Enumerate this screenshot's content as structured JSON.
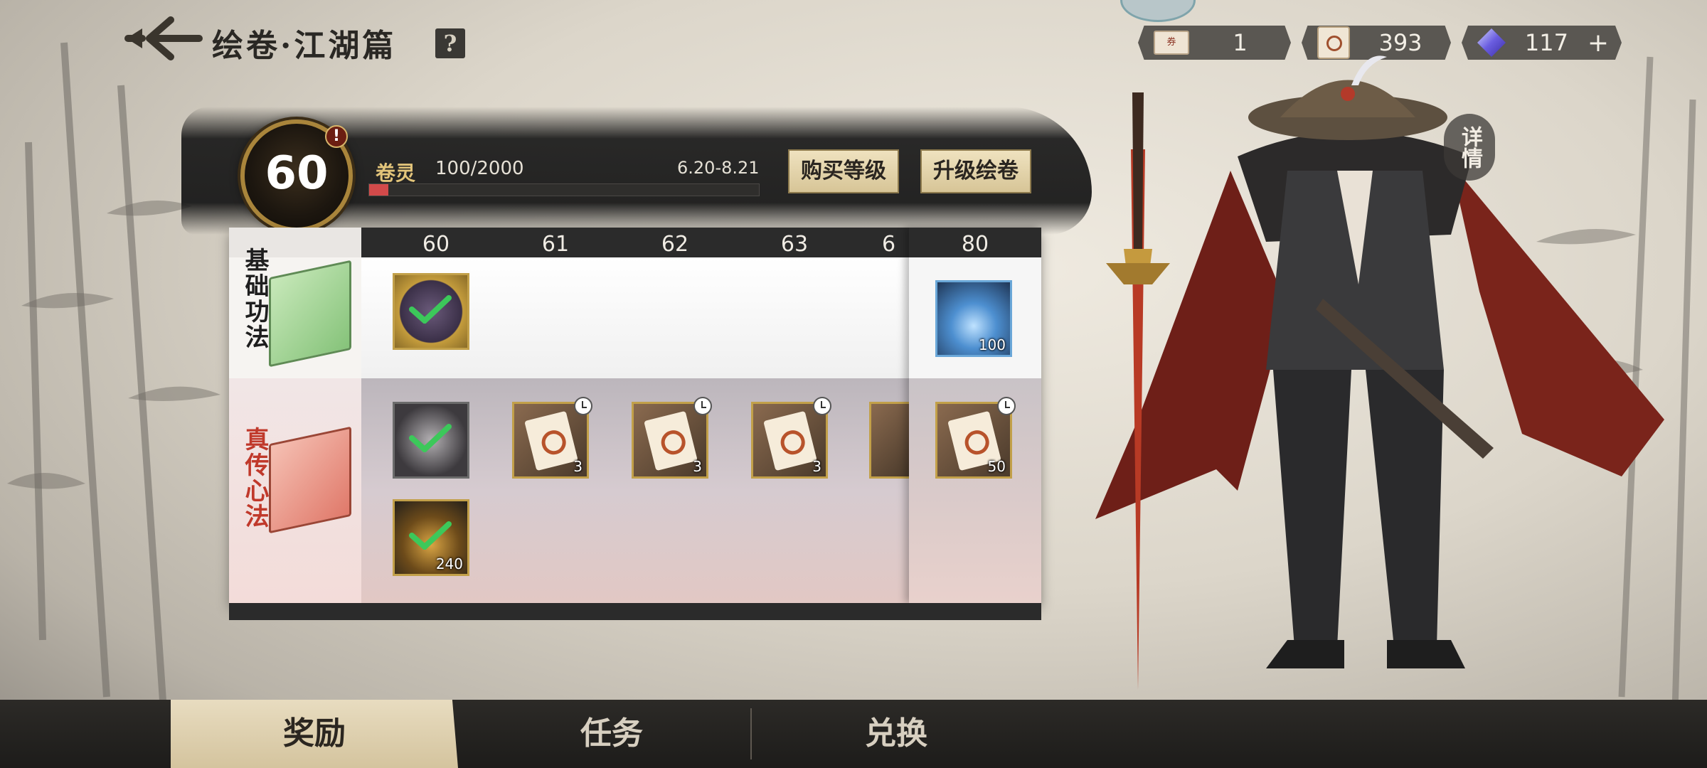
{
  "header": {
    "title": "绘卷·江湖篇",
    "help_label": "?"
  },
  "currencies": [
    {
      "icon": "ticket-icon",
      "value": "1"
    },
    {
      "icon": "scroll-token-icon",
      "value": "393"
    },
    {
      "icon": "gem-icon",
      "value": "117",
      "add_label": "+"
    }
  ],
  "pass": {
    "level": "60",
    "alert": "!",
    "exp_name": "卷灵",
    "exp_value": "100/2000",
    "exp_progress": 0.05,
    "date_range": "6.20-8.21",
    "buy_level_label": "购买等级",
    "upgrade_label": "升级绘卷"
  },
  "board": {
    "levels": [
      "60",
      "61",
      "62",
      "63",
      "6"
    ],
    "milestone_level": "80",
    "tiers": {
      "basic": "基础功法",
      "premium": "真传心法"
    },
    "basic_rewards": [
      {
        "level": "60",
        "icon": "portrait-reward-icon",
        "claimed": true
      }
    ],
    "basic_milestone": {
      "icon": "spirit-crystal-icon",
      "qty": "100"
    },
    "premium_rewards": [
      {
        "level": "60",
        "icon": "portrait-frame-icon",
        "claimed": true
      },
      {
        "level": "60",
        "icon": "flame-material-icon",
        "qty": "240",
        "claimed": true
      },
      {
        "level": "61",
        "icon": "scroll-token-icon",
        "qty": "3",
        "timed": true
      },
      {
        "level": "62",
        "icon": "scroll-token-icon",
        "qty": "3",
        "timed": true
      },
      {
        "level": "63",
        "icon": "scroll-token-icon",
        "qty": "3",
        "timed": true
      }
    ],
    "premium_milestone": {
      "icon": "scroll-token-icon",
      "qty": "50",
      "timed": true
    }
  },
  "details_label": "详情",
  "tabs": {
    "reward": "奖励",
    "task": "任务",
    "exchange": "兑换"
  },
  "colors": {
    "accent_gold": "#c2a049",
    "premium_red": "#c0392b",
    "progress_red": "#d24a4a"
  }
}
